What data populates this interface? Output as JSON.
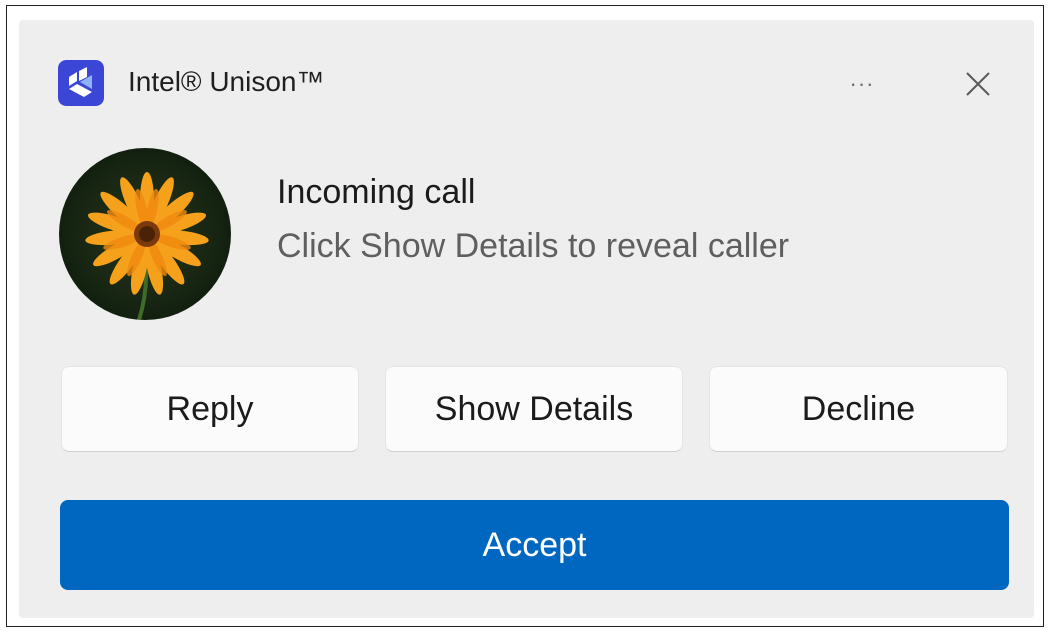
{
  "header": {
    "app_name": "Intel® Unison™",
    "app_icon": "intel-unison-logo",
    "more_label": "···",
    "close_icon": "close-icon"
  },
  "notification": {
    "title": "Incoming call",
    "subtitle": "Click Show Details to reveal caller",
    "avatar": "orange-flower-photo"
  },
  "actions": {
    "reply": "Reply",
    "show_details": "Show Details",
    "decline": "Decline",
    "accept": "Accept"
  },
  "colors": {
    "accent": "#0067c0",
    "toast_background": "#eeeeee",
    "button_background": "#fbfbfb"
  }
}
